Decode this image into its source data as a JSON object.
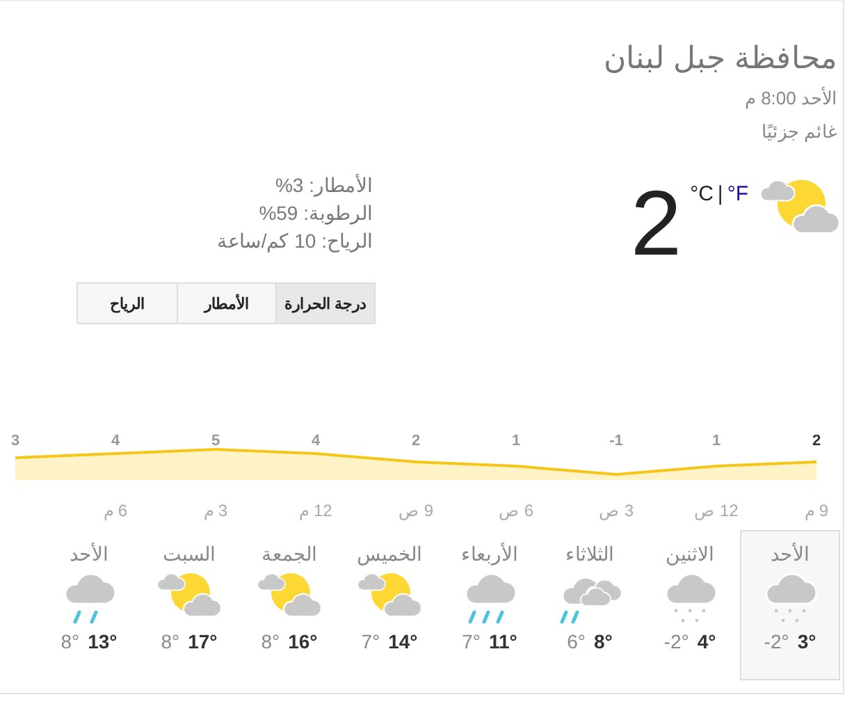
{
  "location": "محافظة جبل لبنان",
  "datetime": "الأحد 8:00 م",
  "condition": "غائم جزئيًا",
  "current": {
    "kind": "partly_cloudy",
    "temperature": "2",
    "units": [
      {
        "label": "°F",
        "selected": false
      },
      {
        "label": "°C",
        "selected": true
      }
    ],
    "unit_separator": "|"
  },
  "details": [
    "الأمطار: 3%",
    "الرطوبة: 59%",
    "الرياح: 10 كم/ساعة"
  ],
  "tabs": [
    {
      "label": "درجة الحرارة",
      "selected": true
    },
    {
      "label": "الأمطار",
      "selected": false
    },
    {
      "label": "الرياح",
      "selected": false
    }
  ],
  "chart_data": {
    "type": "area",
    "categories": [
      null,
      "6 م",
      "3 م",
      "12 م",
      "9 ص",
      "6 ص",
      "3 ص",
      "12 ص",
      "9 م"
    ],
    "values": [
      3,
      4,
      5,
      4,
      2,
      1,
      -1,
      1,
      2
    ],
    "data_labels": true
  },
  "days": [
    {
      "day": "الأحد",
      "kind": "snow",
      "low": "-2°",
      "high": "3°",
      "selected": true
    },
    {
      "day": "الاثنين",
      "kind": "snow",
      "low": "-2°",
      "high": "4°",
      "selected": false
    },
    {
      "day": "الثلاثاء",
      "kind": "rain_clouds",
      "low": "6°",
      "high": "8°",
      "selected": false
    },
    {
      "day": "الأربعاء",
      "kind": "rain",
      "low": "7°",
      "high": "11°",
      "selected": false
    },
    {
      "day": "الخميس",
      "kind": "partly_cloudy",
      "low": "7°",
      "high": "14°",
      "selected": false
    },
    {
      "day": "الجمعة",
      "kind": "partly_cloudy",
      "low": "8°",
      "high": "16°",
      "selected": false
    },
    {
      "day": "السبت",
      "kind": "partly_cloudy",
      "low": "8°",
      "high": "17°",
      "selected": false
    },
    {
      "day": "الأحد",
      "kind": "light_rain",
      "low": "8°",
      "high": "13°",
      "selected": false
    }
  ]
}
